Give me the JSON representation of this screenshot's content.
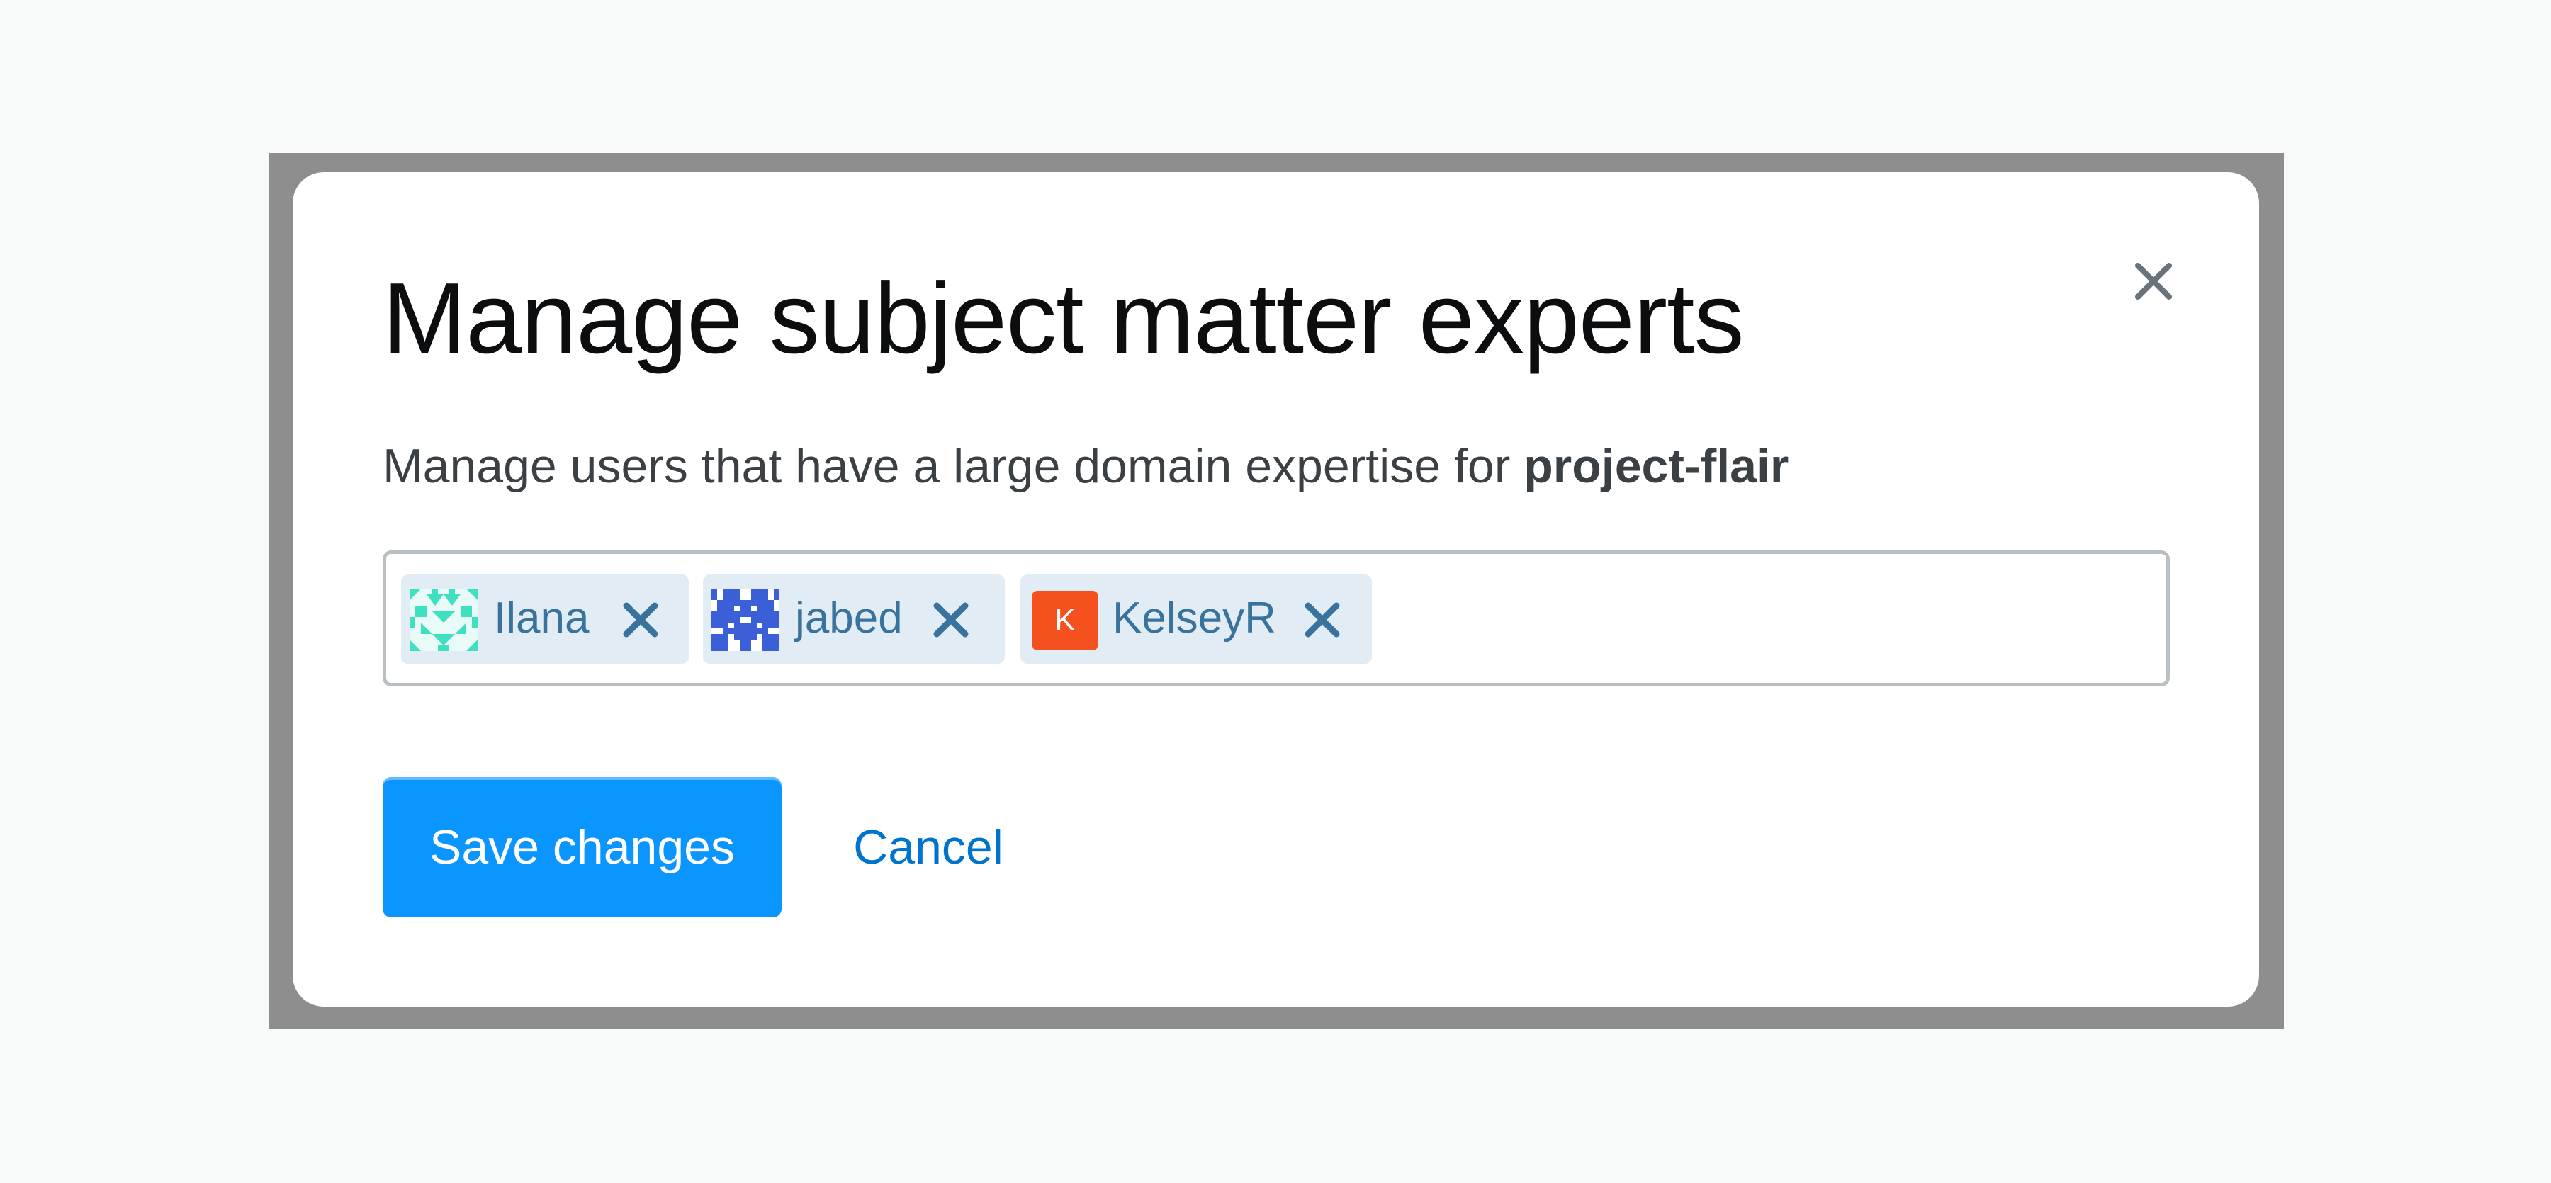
{
  "dialog": {
    "title": "Manage subject matter experts",
    "description_prefix": "Manage users that have a large domain expertise for ",
    "project_name": "project-flair",
    "close_label": "×"
  },
  "experts": [
    {
      "name": "Ilana",
      "avatar_icon": "identicon-teal-icon"
    },
    {
      "name": "jabed",
      "avatar_icon": "identicon-blue-icon"
    },
    {
      "name": "KelseyR",
      "avatar_icon": "letter-avatar-icon",
      "avatar_letter": "K"
    }
  ],
  "actions": {
    "save_label": "Save changes",
    "cancel_label": "Cancel"
  },
  "colors": {
    "primary": "#0a95ff",
    "link": "#0074cc",
    "tag_bg": "#e1ecf4",
    "tag_text": "#39739d",
    "kelsey_avatar": "#f4511e",
    "ilana_avatar": "#3ee0c0",
    "jabed_avatar": "#3b5fd6"
  }
}
